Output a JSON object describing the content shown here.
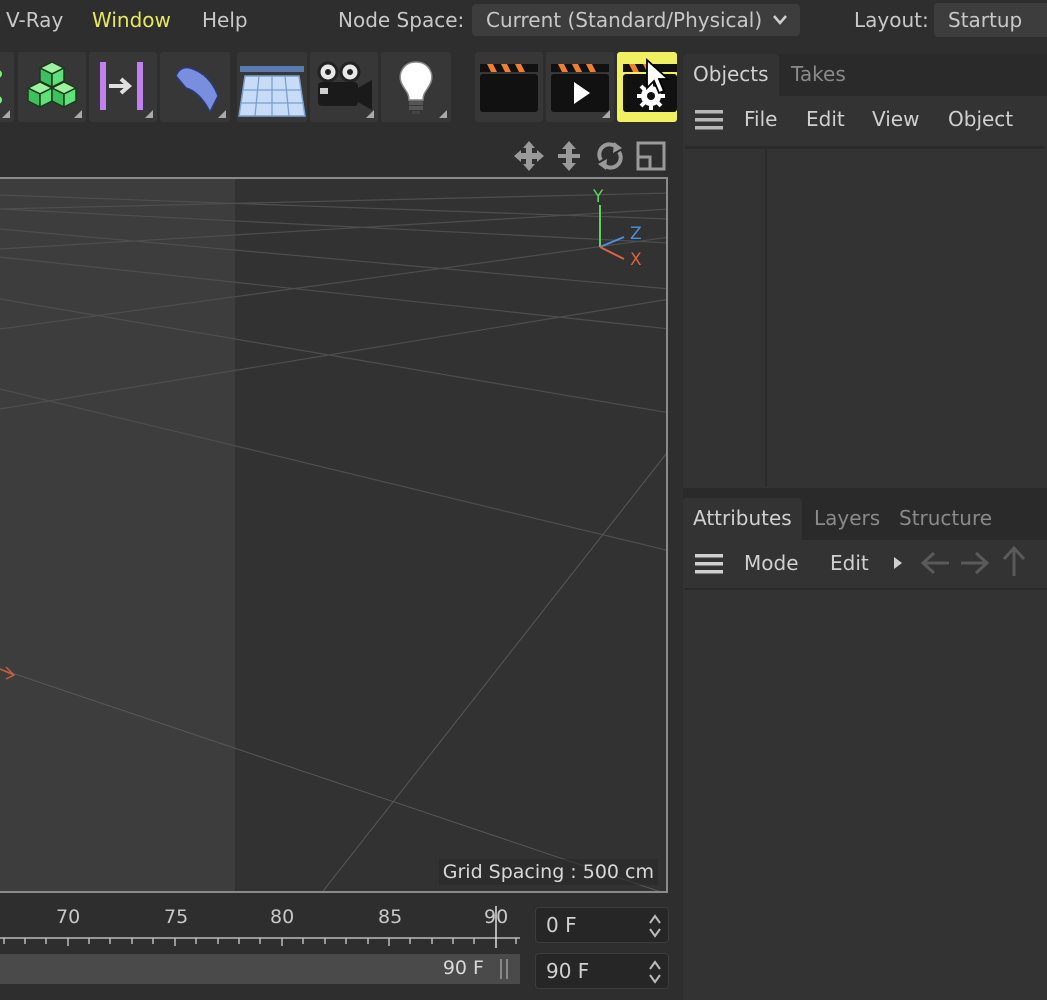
{
  "menubar": {
    "items": [
      "V-Ray",
      "Window",
      "Help"
    ],
    "node_space_label": "Node Space:",
    "node_space_value": "Current (Standard/Physical)",
    "layout_label": "Layout:",
    "layout_value": "Startup"
  },
  "toolbar": {
    "buttons": [
      "spline-icon",
      "cube-icon",
      "symmetry-icon",
      "bend-deformer-icon",
      "floor-icon",
      "camera-icon",
      "light-icon",
      "render-view-icon",
      "render-picture-viewer-icon",
      "render-settings-icon"
    ],
    "highlighted": "render-settings-icon",
    "highlight_color": "#f0f060"
  },
  "viewport": {
    "nav_icons": [
      "move-view-icon",
      "zoom-view-icon",
      "rotate-view-icon",
      "maximize-view-icon"
    ],
    "axis": {
      "y": "Y",
      "z": "Z",
      "x": "X"
    },
    "grid_spacing_label": "Grid Spacing : 500 cm"
  },
  "timeline": {
    "ticks": [
      "70",
      "75",
      "80",
      "85",
      "90"
    ],
    "end_label": "90 F",
    "current_frame": "0 F",
    "end_frame": "90 F"
  },
  "objects_panel": {
    "tabs": [
      "Objects",
      "Takes"
    ],
    "menu": [
      "File",
      "Edit",
      "View",
      "Object"
    ]
  },
  "attributes_panel": {
    "tabs": [
      "Attributes",
      "Layers",
      "Structure"
    ],
    "menu": [
      "Mode",
      "Edit"
    ]
  }
}
